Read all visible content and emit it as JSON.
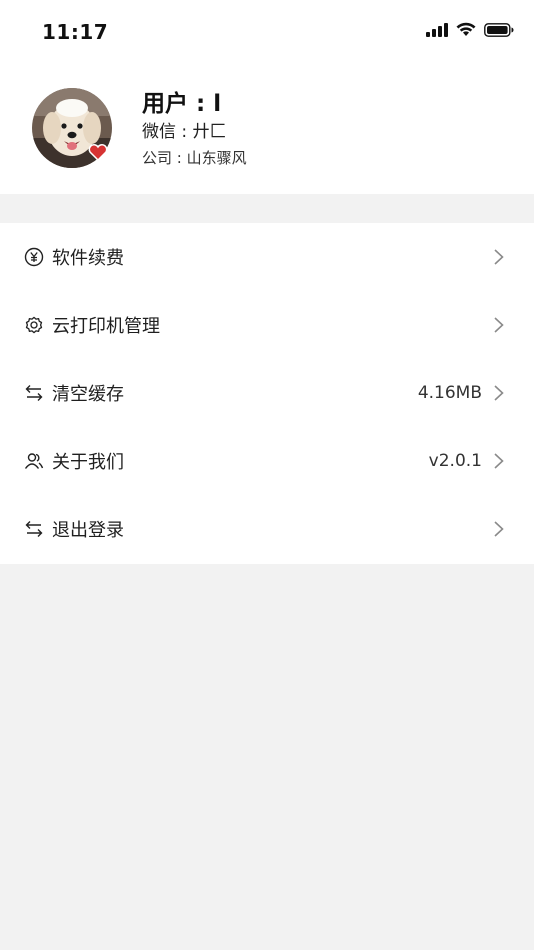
{
  "status_bar": {
    "time": "11:17",
    "icons": [
      "cellular-signal-icon",
      "wifi-icon",
      "battery-icon"
    ]
  },
  "profile": {
    "name": "用户 : l",
    "wechat": "微信 : 廾匚",
    "company": "公司 : 山东骤风",
    "avatar_icon": "dog-avatar-icon"
  },
  "menu": {
    "items": [
      {
        "label": "软件续费",
        "value": "",
        "icon": "yen-circle-icon"
      },
      {
        "label": "云打印机管理",
        "value": "",
        "icon": "gear-icon"
      },
      {
        "label": "清空缓存",
        "value": "4.16MB",
        "icon": "swap-arrows-icon"
      },
      {
        "label": "关于我们",
        "value": "v2.0.1",
        "icon": "users-icon"
      },
      {
        "label": "退出登录",
        "value": "",
        "icon": "swap-arrows-icon"
      }
    ]
  },
  "colors": {
    "page_background": "#f2f2f2",
    "card_background": "#ffffff",
    "text_primary": "#1a1a1a",
    "chevron": "#8a8a8a"
  }
}
